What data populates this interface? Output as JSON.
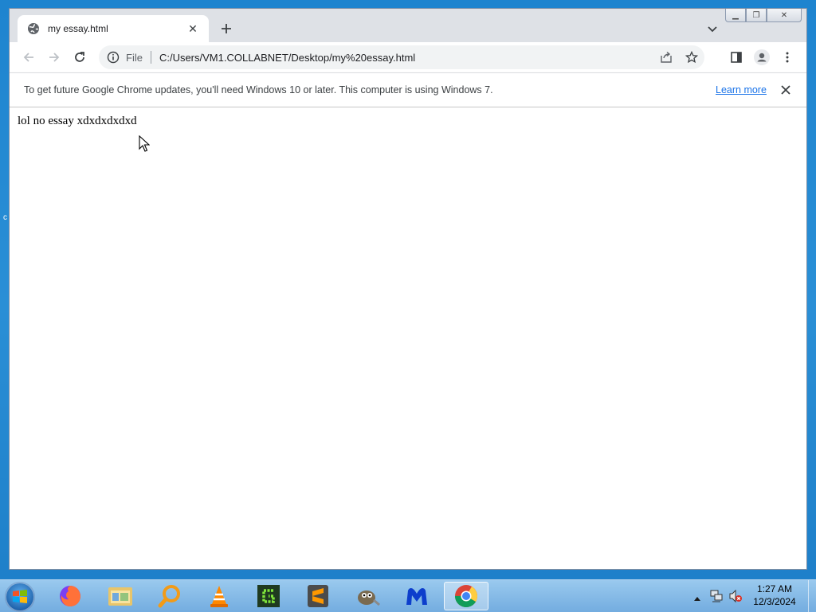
{
  "browser": {
    "tab": {
      "title": "my essay.html"
    },
    "omnibox": {
      "scheme": "File",
      "url": "C:/Users/VM1.COLLABNET/Desktop/my%20essay.html"
    },
    "infobar": {
      "message": "To get future Google Chrome updates, you'll need Windows 10 or later. This computer is using Windows 7.",
      "link": "Learn more"
    },
    "page": {
      "text": "lol no essay xdxdxdxdxd"
    }
  },
  "taskbar": {
    "apps": [
      "firefox-icon",
      "explorer-icon",
      "search-tool-icon",
      "vlc-icon",
      "gamemaker-icon",
      "sublime-icon",
      "gimp-icon",
      "malwarebytes-icon",
      "chrome-icon"
    ],
    "clock": {
      "time": "1:27 AM",
      "date": "12/3/2024"
    }
  },
  "colors": {
    "accent": "#1a73e8",
    "desktop": "#1e84cf",
    "tabstrip": "#dee1e6"
  }
}
